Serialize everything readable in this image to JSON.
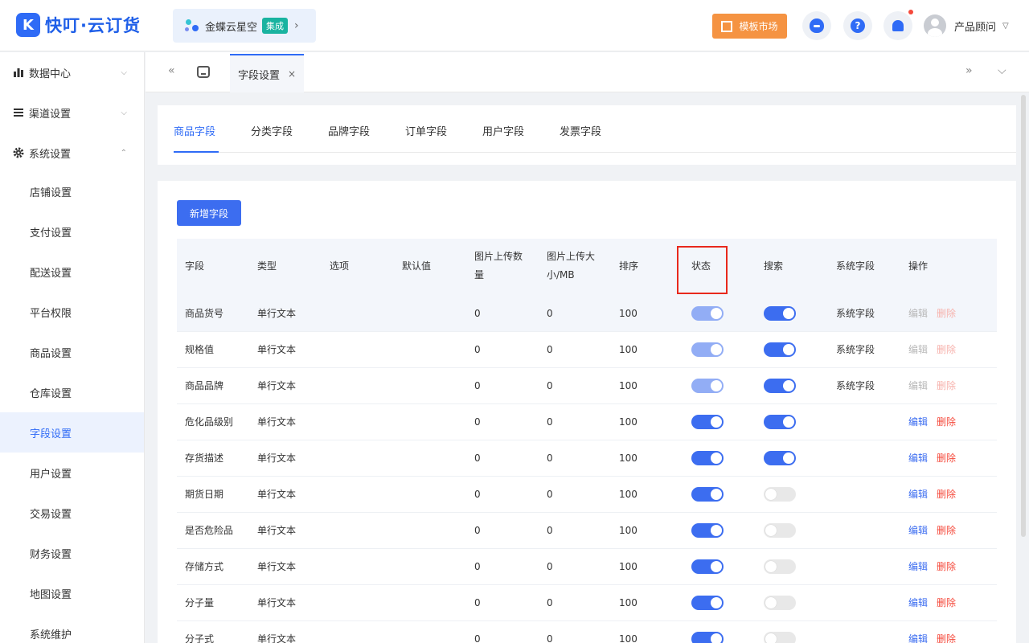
{
  "app": {
    "logo_mark": "K",
    "logo_text": "快叮·云订货",
    "kd_banner": {
      "text": "金蝶云星空",
      "badge": "集成",
      "arrow": "›"
    },
    "market_button": "模板市场",
    "help_glyph": "?",
    "user_name": "产品顾问",
    "user_caret": "▽"
  },
  "sidebar": {
    "groups": [
      {
        "label": "数据中心",
        "icon": "bar-chart-icon",
        "chevron": "⌵"
      },
      {
        "label": "渠道设置",
        "icon": "list-icon",
        "chevron": "⌵"
      },
      {
        "label": "系统设置",
        "icon": "gear-icon",
        "chevron": "⌃"
      }
    ],
    "items": [
      "店铺设置",
      "支付设置",
      "配送设置",
      "平台权限",
      "商品设置",
      "仓库设置",
      "字段设置",
      "用户设置",
      "交易设置",
      "财务设置",
      "地图设置",
      "系统维护"
    ],
    "active_item": "字段设置"
  },
  "tabbar": {
    "collapse_left": "«",
    "page_tab": "字段设置",
    "close": "×",
    "expand_right": "»",
    "dropdown": "⌵"
  },
  "field_tabs": [
    "商品字段",
    "分类字段",
    "品牌字段",
    "订单字段",
    "用户字段",
    "发票字段"
  ],
  "active_field_tab": "商品字段",
  "add_button": "新增字段",
  "table": {
    "headers": {
      "field": "字段",
      "type": "类型",
      "options": "选项",
      "default": "默认值",
      "img_count_1": "图片上传数",
      "img_count_2": "量",
      "img_size_1": "图片上传大",
      "img_size_2": "小/MB",
      "sort": "排序",
      "status": "状态",
      "search": "搜索",
      "system": "系统字段",
      "actions": "操作"
    },
    "edit_label": "编辑",
    "delete_label": "删除",
    "rows": [
      {
        "field": "商品货号",
        "type": "单行文本",
        "options": "",
        "default": "",
        "img_count": "0",
        "img_size": "0",
        "sort": "100",
        "status": "on",
        "status_locked": true,
        "search": "on",
        "system": "系统字段"
      },
      {
        "field": "规格值",
        "type": "单行文本",
        "options": "",
        "default": "",
        "img_count": "0",
        "img_size": "0",
        "sort": "100",
        "status": "on",
        "status_locked": true,
        "search": "on",
        "system": "系统字段"
      },
      {
        "field": "商品品牌",
        "type": "单行文本",
        "options": "",
        "default": "",
        "img_count": "0",
        "img_size": "0",
        "sort": "100",
        "status": "on",
        "status_locked": true,
        "search": "on",
        "system": "系统字段"
      },
      {
        "field": "危化品级别",
        "type": "单行文本",
        "options": "",
        "default": "",
        "img_count": "0",
        "img_size": "0",
        "sort": "100",
        "status": "on",
        "status_locked": false,
        "search": "on",
        "system": ""
      },
      {
        "field": "存货描述",
        "type": "单行文本",
        "options": "",
        "default": "",
        "img_count": "0",
        "img_size": "0",
        "sort": "100",
        "status": "on",
        "status_locked": false,
        "search": "on",
        "system": ""
      },
      {
        "field": "期货日期",
        "type": "单行文本",
        "options": "",
        "default": "",
        "img_count": "0",
        "img_size": "0",
        "sort": "100",
        "status": "on",
        "status_locked": false,
        "search": "off",
        "system": ""
      },
      {
        "field": "是否危险品",
        "type": "单行文本",
        "options": "",
        "default": "",
        "img_count": "0",
        "img_size": "0",
        "sort": "100",
        "status": "on",
        "status_locked": false,
        "search": "off",
        "system": ""
      },
      {
        "field": "存储方式",
        "type": "单行文本",
        "options": "",
        "default": "",
        "img_count": "0",
        "img_size": "0",
        "sort": "100",
        "status": "on",
        "status_locked": false,
        "search": "off",
        "system": ""
      },
      {
        "field": "分子量",
        "type": "单行文本",
        "options": "",
        "default": "",
        "img_count": "0",
        "img_size": "0",
        "sort": "100",
        "status": "on",
        "status_locked": false,
        "search": "off",
        "system": ""
      },
      {
        "field": "分子式",
        "type": "单行文本",
        "options": "",
        "default": "",
        "img_count": "0",
        "img_size": "0",
        "sort": "100",
        "status": "on",
        "status_locked": false,
        "search": "off",
        "system": ""
      }
    ]
  },
  "colors": {
    "primary": "#3c6df0",
    "highlight_box": "#e8291c",
    "market_orange": "#f59342",
    "delete_red": "#f5493b"
  }
}
